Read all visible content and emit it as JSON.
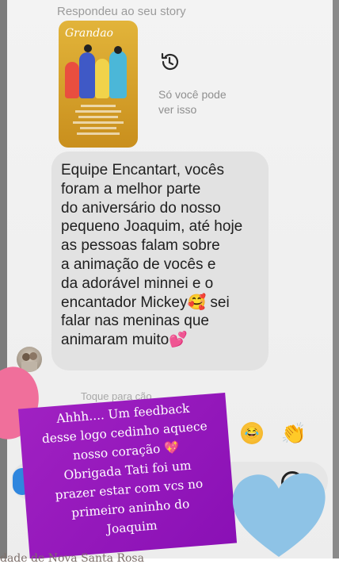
{
  "story_reply": {
    "header": "Respondeu ao seu story",
    "thumbnail_title": "Grandao",
    "only_you_text": "Só você pode\nver isso",
    "history_icon": "history-icon"
  },
  "message": {
    "text": "Equipe Encantart, vocês\nforam a melhor parte\ndo aniversário do nosso\npequeno Joaquim, até hoje\nas pessoas falam sobre\na animação de vocês e\nda adorável minnei e o\nencantador Mickey🥰 sei\nfalar nas meninas que\nanimaram muito💕"
  },
  "tap_hint": "Toque para                        ção.",
  "overlay": {
    "line1": "Ahhh.... Um feedback",
    "line2": "desse logo cedinho aquece",
    "line3": "nosso coração",
    "line3_emoji": "💖",
    "line4": "Obrigada Tati foi um",
    "line5": "prazer estar com vcs no",
    "line6": "primeiro aninho do",
    "line7": "Joaquim"
  },
  "reactions": {
    "face": "😂",
    "clap": "👏"
  },
  "footer": "dade de Nova Santa Rosa",
  "colors": {
    "overlay_purple": "#9a1cc0",
    "heart_pink": "#f06f9b",
    "heart_blue": "#8ec3e6",
    "bubble": "#e2e2e2"
  }
}
